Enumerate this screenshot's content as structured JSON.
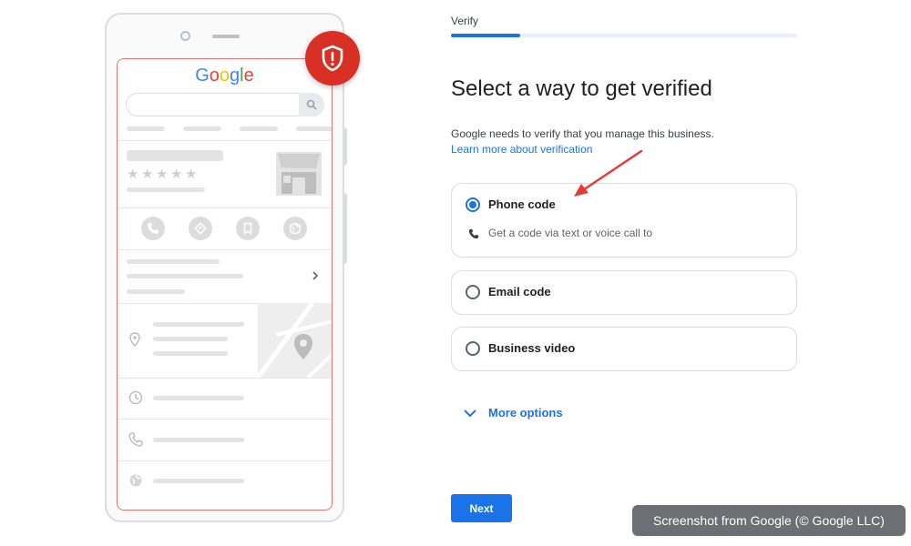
{
  "wizard": {
    "step_label": "Verify",
    "progress_fraction": 0.2,
    "title": "Select a way to get verified",
    "description": "Google needs to verify that you manage this business.",
    "learn_more_link": "Learn more about verification",
    "options": [
      {
        "label": "Phone code",
        "selected": true,
        "detail": "Get a code via text or voice call to",
        "detail_icon": "phone-icon"
      },
      {
        "label": "Email code",
        "selected": false
      },
      {
        "label": "Business video",
        "selected": false
      }
    ],
    "more_options": "More options",
    "next_button": "Next"
  },
  "illustration": {
    "logo_letters": [
      "G",
      "o",
      "o",
      "g",
      "l",
      "e"
    ],
    "logo_colors": [
      "#4285F4",
      "#EA4335",
      "#FBBC05",
      "#4285F4",
      "#34A853",
      "#EA4335"
    ],
    "badge_icon": "shield-alert-icon",
    "badge_color": "#D93025",
    "star_count": 5,
    "action_icons": [
      "phone-icon",
      "directions-icon",
      "bookmark-icon",
      "globe-icon"
    ],
    "list_icons": [
      "location-pin-icon",
      "clock-icon",
      "phone-icon",
      "globe-icon"
    ]
  },
  "accent_color": "#1A73E8",
  "annotation_arrow_color": "#E53935",
  "credit": "Screenshot from Google (© Google LLC)"
}
